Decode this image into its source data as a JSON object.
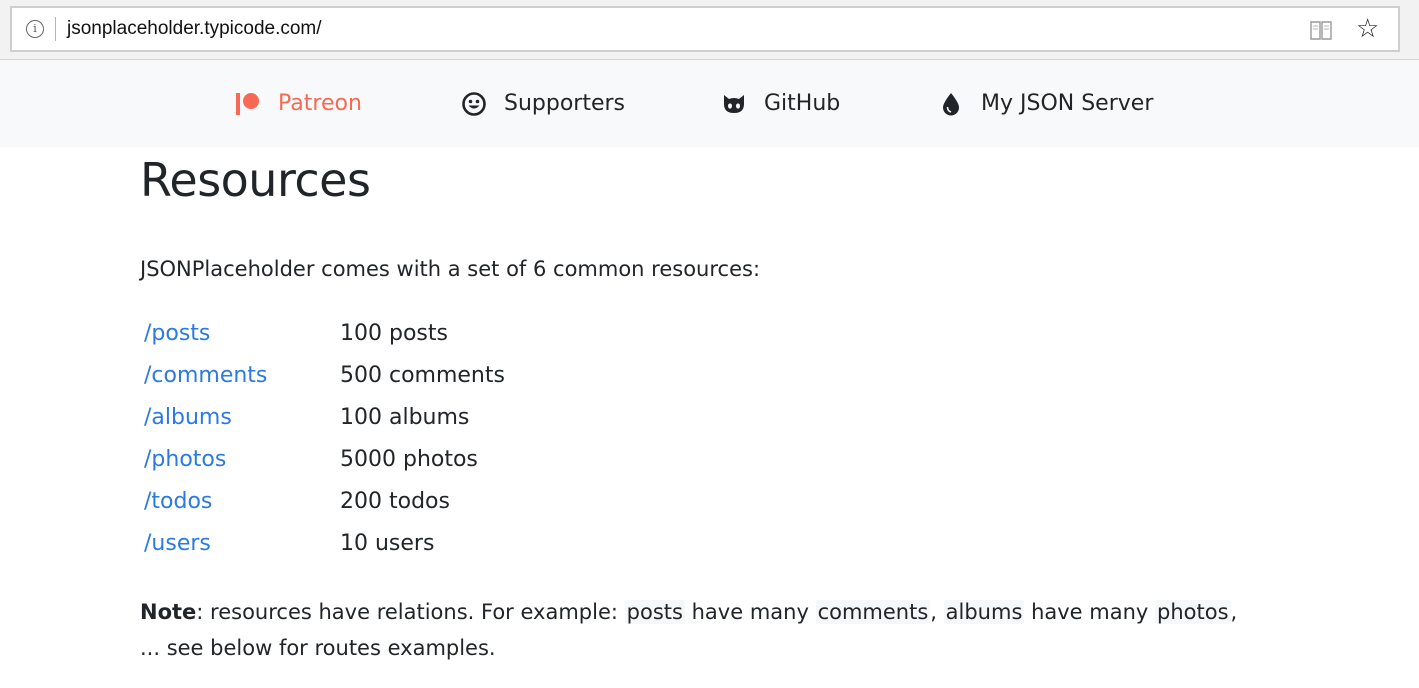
{
  "browser": {
    "url": "jsonplaceholder.typicode.com/",
    "info_glyph": "i",
    "icons": [
      "info-icon",
      "reading-view-icon",
      "star-icon"
    ]
  },
  "nav": {
    "items": [
      {
        "label": "Patreon",
        "icon": "patreon-icon",
        "color": "#f96854"
      },
      {
        "label": "Supporters",
        "icon": "smiley-icon"
      },
      {
        "label": "GitHub",
        "icon": "github-icon"
      },
      {
        "label": "My JSON Server",
        "icon": "droplet-icon"
      }
    ]
  },
  "main": {
    "title": "Resources",
    "intro": "JSONPlaceholder comes with a set of 6 common resources:",
    "resources": [
      {
        "path": "/posts",
        "count": "100 posts"
      },
      {
        "path": "/comments",
        "count": "500 comments"
      },
      {
        "path": "/albums",
        "count": "100 albums"
      },
      {
        "path": "/photos",
        "count": "5000 photos"
      },
      {
        "path": "/todos",
        "count": "200 todos"
      },
      {
        "path": "/users",
        "count": "10 users"
      }
    ],
    "note": {
      "label": "Note",
      "t1": ": resources have relations. For example: ",
      "c1": "posts",
      "t2": " have many ",
      "c2": "comments",
      "t3": ", ",
      "c3": "albums",
      "t4": " have many ",
      "c4": "photos",
      "t5": ", ... see below for routes examples."
    }
  },
  "colors": {
    "link": "#2a7ae2",
    "patreon": "#f96854",
    "nav_bg": "#f8f9fa",
    "text": "#212529"
  }
}
